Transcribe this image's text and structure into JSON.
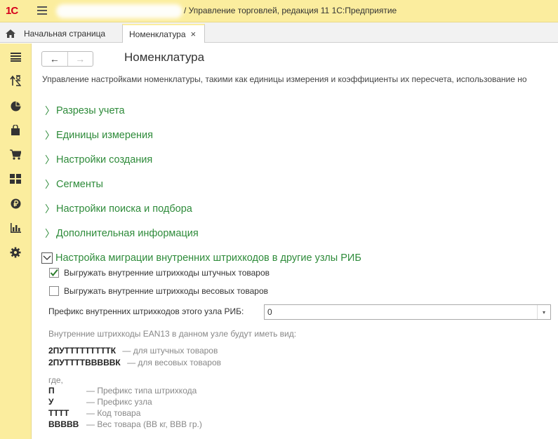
{
  "titlebar": {
    "logo": "1С",
    "title": "/ Управление торговлей, редакция 11 1С:Предприятие"
  },
  "tabs": [
    {
      "label": "Начальная страница"
    },
    {
      "label": "Номенклатура",
      "close": "×"
    }
  ],
  "sidebar": {
    "icons": [
      "menu-icon",
      "sort-arrows-icon",
      "pie-chart-icon",
      "shopping-bag-icon",
      "cart-icon",
      "grid-icon",
      "ruble-icon",
      "bar-chart-icon",
      "gear-icon"
    ]
  },
  "nav": {
    "back": "←",
    "forward": "→"
  },
  "page": {
    "title": "Номенклатура",
    "description": "Управление настройками номенклатуры, такими как единицы измерения и коэффициенты их пересчета, использование но"
  },
  "sections": [
    {
      "label": "Разрезы учета"
    },
    {
      "label": "Единицы измерения"
    },
    {
      "label": "Настройки создания"
    },
    {
      "label": "Сегменты"
    },
    {
      "label": "Настройки поиска и подбора"
    },
    {
      "label": "Дополнительная информация"
    },
    {
      "label": "Настройка миграции внутренних штрихкодов в другие узлы РИБ"
    }
  ],
  "options": [
    {
      "label": "Выгружать внутренние штрихкоды штучных товаров",
      "checked": true
    },
    {
      "label": "Выгружать внутренние штрихкоды весовых товаров",
      "checked": false
    }
  ],
  "prefix": {
    "label": "Префикс внутренних штрихкодов этого узла РИБ:",
    "value": "0",
    "dropdown": "▾"
  },
  "info": {
    "heading": "Внутренние штрихкоды EAN13 в данном узле будут иметь вид:",
    "formats": [
      {
        "code": "2ПУТТТТТТТТТК",
        "desc": "— для штучных товаров"
      },
      {
        "code": "2ПУТТТТВВВВВК",
        "desc": "— для весовых товаров"
      }
    ],
    "where": "где,",
    "legend": [
      {
        "key": "П",
        "desc": "— Префикс типа штрихкода"
      },
      {
        "key": "У",
        "desc": "— Префикс узла"
      },
      {
        "key": "ТТТТ",
        "desc": "— Код товара"
      },
      {
        "key": "ВВВВВ",
        "desc": "— Вес товара (ВВ кг, ВВВ гр.)"
      }
    ]
  },
  "colors": {
    "titlebar_bg": "#fbed9e",
    "section_green": "#2e8b3a",
    "logo_red": "#d6001c"
  }
}
